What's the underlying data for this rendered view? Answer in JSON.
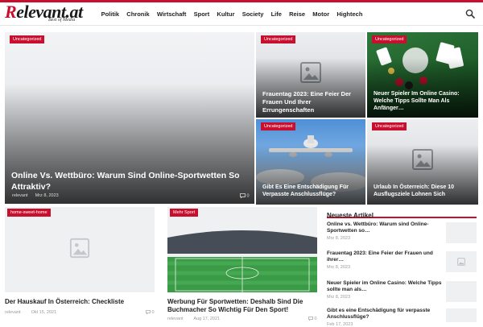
{
  "site": {
    "logo_text": "Relevant.at",
    "logo_r": "R",
    "logo_rest": "elevant.at",
    "tagline": "Best of Media"
  },
  "nav": {
    "items": [
      "Politik",
      "Chronik",
      "Wirtschaft",
      "Sport",
      "Kultur",
      "Society",
      "Life",
      "Reise",
      "Motor",
      "Hightech"
    ]
  },
  "hero": [
    {
      "category": "Uncategorized",
      "title": "Online Vs. Wettbüro: Warum Sind Online-Sportwetten So Attraktiv?",
      "author": "relevant",
      "date": "Mrz 8, 2023",
      "comments": "0"
    },
    {
      "category": "Uncategorized",
      "title": "Frauentag 2023: Eine Feier Der Frauen Und Ihrer Errungenschaften"
    },
    {
      "category": "Uncategorized",
      "title": "Neuer Spieler Im Online Casino: Welche Tipps Sollte Man Als Anfänger…"
    },
    {
      "category": "Uncategorized",
      "title": "Gibt Es Eine Entschädigung Für Verpasste Anschlussflüge?"
    },
    {
      "category": "Uncategorized",
      "title": "Urlaub In Österreich: Diese 10 Ausflugsziele Lohnen Sich"
    }
  ],
  "cards": [
    {
      "category": "home-sweet-home",
      "title": "Der Hauskauf In Österreich: Checkliste",
      "author": "relevant",
      "date": "Okt 15, 2021",
      "comments": "0"
    },
    {
      "category": "Mehr Sport",
      "title": "Werbung Für Sportwetten: Deshalb Sind Die Buchmacher So Wichtig Für Den Sport!",
      "author": "relevant",
      "date": "Aug 17, 2021",
      "comments": "0"
    }
  ],
  "sidebar": {
    "heading": "Neueste Artikel",
    "items": [
      {
        "title": "Online vs. Wettbüro: Warum sind Online-Sportwetten so…",
        "date": "Mrz 8, 2023"
      },
      {
        "title": "Frauentag 2023: Eine Feier der Frauen und ihrer…",
        "date": "Mrz 8, 2023"
      },
      {
        "title": "Neuer Spieler im Online Casino: Welche Tipps sollte man als…",
        "date": "Mrz 8, 2023"
      },
      {
        "title": "Gibt es eine Entschädigung für verpasste Anschlussflüge?",
        "date": "Feb 17, 2023"
      }
    ]
  },
  "colors": {
    "accent": "#c8102e",
    "text": "#222222",
    "meta": "#999999"
  }
}
